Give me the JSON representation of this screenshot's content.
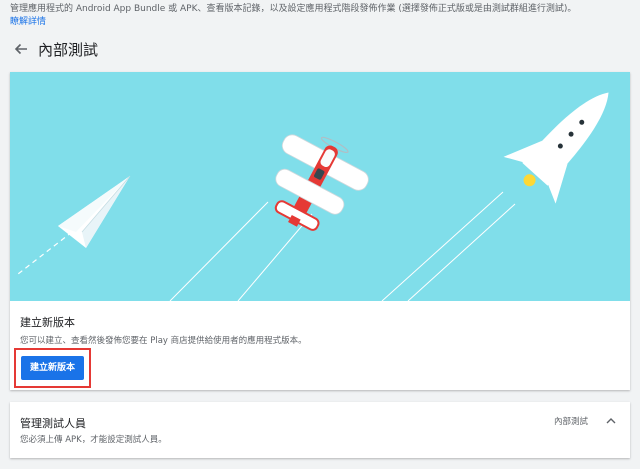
{
  "intro": {
    "text": "管理應用程式的 Android App Bundle 或 APK、查看版本記錄，以及設定應用程式階段發佈作業 (選擇發佈正式版或是由測試群組進行測試)。",
    "learn_more": "瞭解詳情"
  },
  "page": {
    "title": "內部測試"
  },
  "release_card": {
    "title": "建立新版本",
    "description": "您可以建立、查看然後發佈您要在 Play 商店提供給使用者的應用程式版本。",
    "create_button": "建立新版本"
  },
  "testers_card": {
    "title": "管理測試人員",
    "description": "您必須上傳 APK，才能設定測試人員。",
    "track": "內部測試"
  },
  "colors": {
    "hero_background": "#80deea",
    "accent": "#1a73e8",
    "highlight_border": "#e53935",
    "plane_red": "#e53935"
  },
  "icons": {
    "back": "arrow-left-icon",
    "collapse": "chevron-up-icon"
  }
}
